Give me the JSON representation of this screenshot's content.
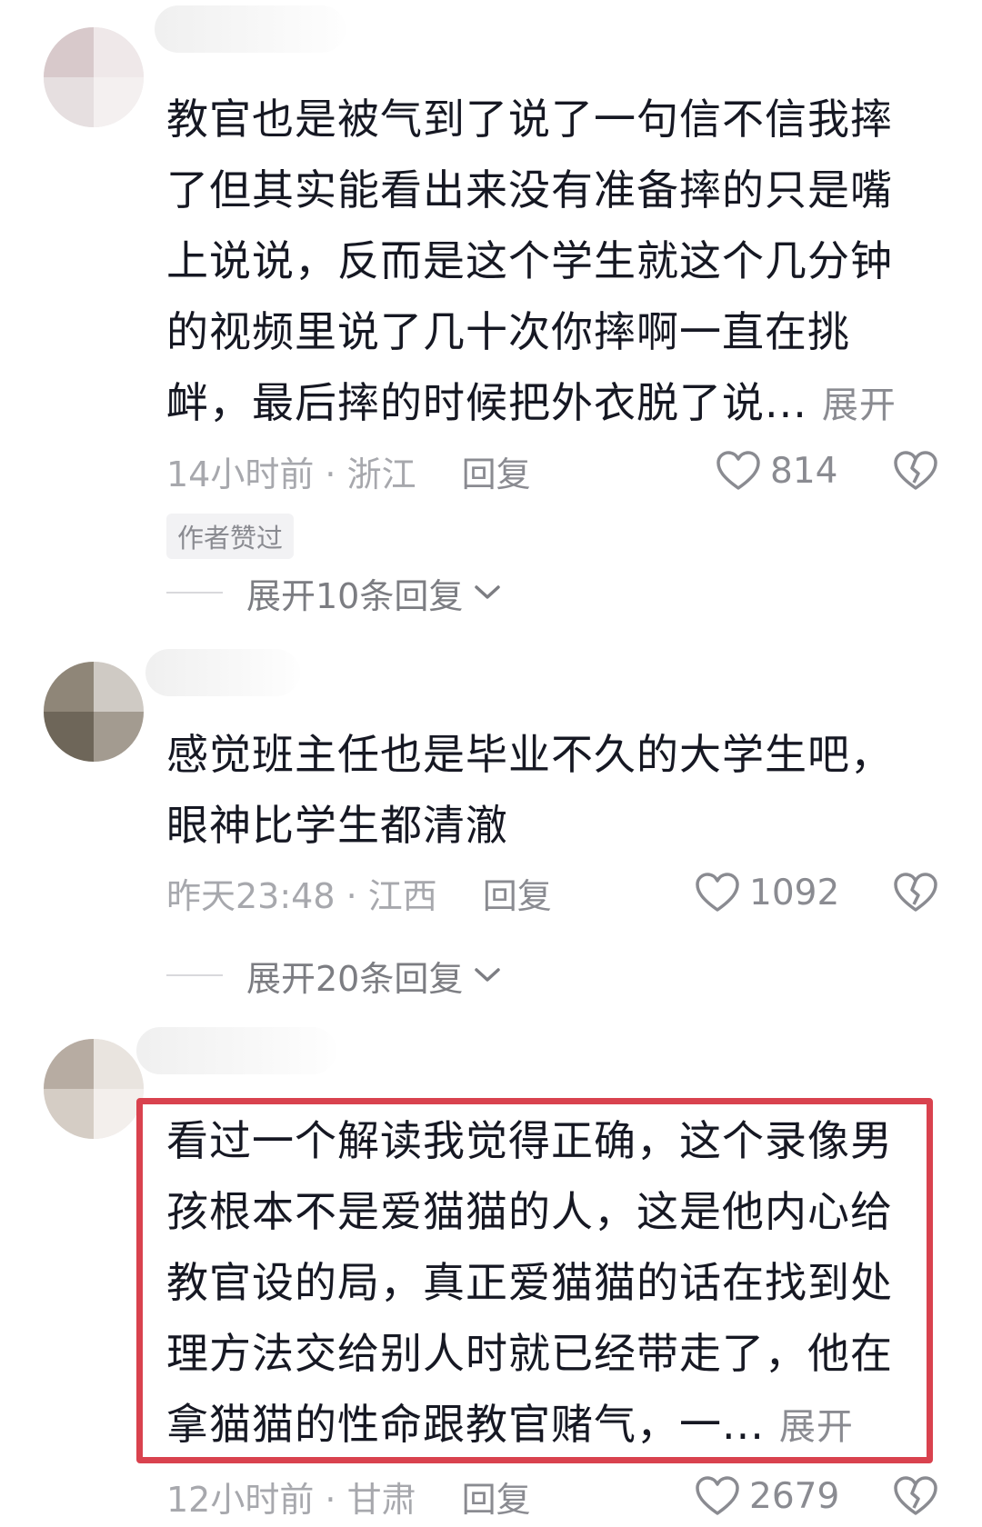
{
  "comments": [
    {
      "text": "教官也是被气到了说了一句信不信我摔了但其实能看出来没有准备摔的只是嘴上说说，反而是这个学生就这个几分钟的视频里说了几十次你摔啊一直在挑衅，最后摔的时候把外衣脱了说...",
      "expand_label": "展开",
      "time_location": "14小时前 · 浙江",
      "reply_label": "回复",
      "likes": "814",
      "badge": "作者赞过",
      "more_replies": "展开10条回复"
    },
    {
      "text": "感觉班主任也是毕业不久的大学生吧，眼神比学生都清澈",
      "time_location": "昨天23:48 · 江西",
      "reply_label": "回复",
      "likes": "1092",
      "more_replies": "展开20条回复"
    },
    {
      "text": "看过一个解读我觉得正确，这个录像男孩根本不是爱猫猫的人，这是他内心给教官设的局，真正爱猫猫的话在找到处理方法交给别人时就已经带走了，他在拿猫猫的性命跟教官赌气，一...",
      "expand_label": "展开",
      "time_location": "12小时前 · 甘肃",
      "reply_label": "回复",
      "likes": "2679"
    }
  ],
  "icons": {
    "like": "heart-outline-icon",
    "dislike": "broken-heart-icon",
    "chevron": "chevron-down-icon"
  },
  "colors": {
    "highlight_border": "#d9424e",
    "text": "#161823",
    "meta": "#a7a8ad"
  }
}
